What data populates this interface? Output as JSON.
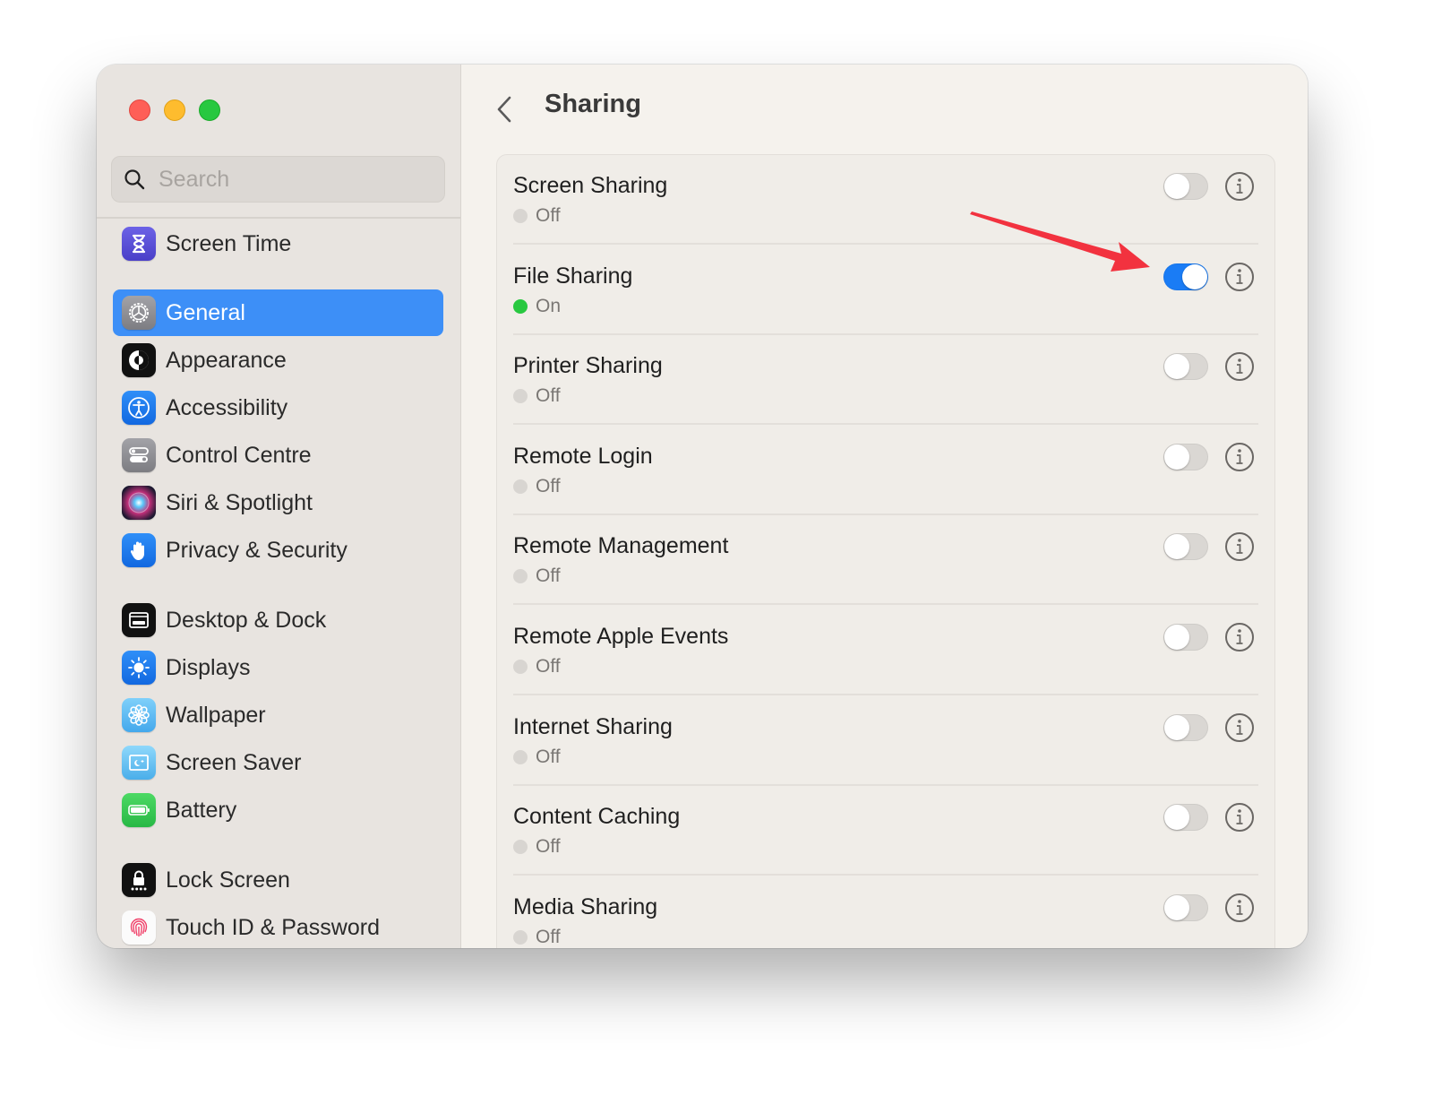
{
  "window": {
    "traffic_lights": [
      "close",
      "minimize",
      "maximize"
    ]
  },
  "sidebar": {
    "search": {
      "placeholder": "Search",
      "value": "",
      "icon": "magnifying-glass-icon"
    },
    "items": [
      {
        "label": "Screen Time",
        "icon": "hourglass-icon",
        "color": "#5b4fd6",
        "active": false
      },
      {
        "label": "General",
        "icon": "gear-icon",
        "color": "#8e8e93",
        "active": true
      },
      {
        "label": "Appearance",
        "icon": "appearance-icon",
        "color": "#000000",
        "active": false
      },
      {
        "label": "Accessibility",
        "icon": "accessibility-icon",
        "color": "#1a7cf5",
        "active": false
      },
      {
        "label": "Control Centre",
        "icon": "control-centre-icon",
        "color": "#8e8e93",
        "active": false
      },
      {
        "label": "Siri & Spotlight",
        "icon": "siri-icon",
        "color": "#3a1a3e",
        "active": false
      },
      {
        "label": "Privacy & Security",
        "icon": "hand-icon",
        "color": "#1a7cf5",
        "active": false
      },
      {
        "label": "Desktop & Dock",
        "icon": "dock-icon",
        "color": "#000000",
        "active": false
      },
      {
        "label": "Displays",
        "icon": "sun-icon",
        "color": "#1a7cf5",
        "active": false
      },
      {
        "label": "Wallpaper",
        "icon": "flower-icon",
        "color": "#5ab8f0",
        "active": false
      },
      {
        "label": "Screen Saver",
        "icon": "screen-saver-icon",
        "color": "#5ab8f0",
        "active": false
      },
      {
        "label": "Battery",
        "icon": "battery-icon",
        "color": "#34c759",
        "active": false
      },
      {
        "label": "Lock Screen",
        "icon": "lock-icon",
        "color": "#000000",
        "active": false
      },
      {
        "label": "Touch ID & Password",
        "icon": "fingerprint-icon",
        "color": "#ffffff",
        "active": false
      }
    ]
  },
  "main": {
    "title": "Sharing",
    "back_icon": "chevron-left-icon",
    "accent": "#1a7cf5",
    "services": [
      {
        "name": "Screen Sharing",
        "status": "Off",
        "enabled": false
      },
      {
        "name": "File Sharing",
        "status": "On",
        "enabled": true
      },
      {
        "name": "Printer Sharing",
        "status": "Off",
        "enabled": false
      },
      {
        "name": "Remote Login",
        "status": "Off",
        "enabled": false
      },
      {
        "name": "Remote Management",
        "status": "Off",
        "enabled": false
      },
      {
        "name": "Remote Apple Events",
        "status": "Off",
        "enabled": false
      },
      {
        "name": "Internet Sharing",
        "status": "Off",
        "enabled": false
      },
      {
        "name": "Content Caching",
        "status": "Off",
        "enabled": false
      },
      {
        "name": "Media Sharing",
        "status": "Off",
        "enabled": false
      }
    ]
  },
  "annotation": {
    "type": "arrow",
    "color": "#f2323f",
    "points_to": "File Sharing toggle"
  }
}
